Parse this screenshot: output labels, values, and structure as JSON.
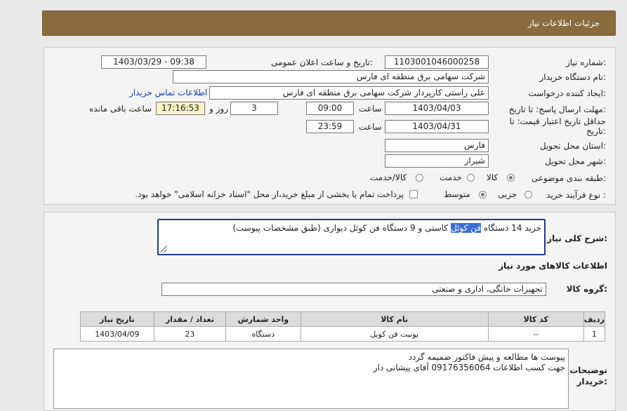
{
  "header": {
    "title": "جزئیات اطلاعات نیاز"
  },
  "form": {
    "need_number": {
      "label": "شماره نیاز:",
      "value": "1103001046000258"
    },
    "announce_datetime": {
      "label": "تاریخ و ساعت اعلان عمومی:",
      "value": "1403/03/29 - 09:38"
    },
    "buyer_org": {
      "label": "نام دستگاه خریدار:",
      "value": "شرکت سهامی برق منطقه ای فارس"
    },
    "requester": {
      "label": "ایجاد کننده درخواست:",
      "value": "علی راستی کارپرداز شرکت سهامی برق منطقه ای فارس",
      "contact_link": "اطلاعات تماس خریدار"
    },
    "reply_deadline": {
      "label": "مهلت ارسال پاسخ: تا تاریخ:",
      "date": "1403/04/03",
      "time_label": "ساعت",
      "time": "09:00",
      "days": "3",
      "days_label": "روز و",
      "remaining": "17:16:53",
      "remaining_label": "ساعت باقی مانده"
    },
    "price_validity": {
      "label": "حداقل تاریخ اعتبار قیمت: تا تاریخ:",
      "date": "1403/04/31",
      "time_label": "ساعت",
      "time": "23:59"
    },
    "province": {
      "label": "استان محل تحویل:",
      "value": "فارس"
    },
    "city": {
      "label": "شهر محل تحویل:",
      "value": "شیراز"
    },
    "category": {
      "label": "طبقه بندی موضوعی:",
      "options": [
        "کالا",
        "خدمت",
        "کالا/خدمت"
      ],
      "selected": "کالا"
    },
    "process_type": {
      "label": "نوع فرآیند خرید :",
      "options": [
        "جزیی",
        "متوسط"
      ],
      "selected": "متوسط",
      "payment_note": "پرداخت تمام یا بخشی از مبلغ خرید،از محل \"اسناد خزانه اسلامی\" خواهد بود."
    }
  },
  "description": {
    "label": "شرح کلی نیاز:",
    "text_before": "خرید 14 دستگاه ",
    "text_highlight": "فن کوئل",
    "text_after": " کاستی و 9 دستگاه فن کوئل دیواری (طبق مشخصات پیوست)"
  },
  "goods": {
    "section_title": "اطلاعات کالاهای مورد نیاز",
    "group_label": "گروه کالا:",
    "group_value": "تجهیزات خانگی، اداری و صنعتی",
    "table": {
      "columns": [
        "ردیف",
        "کد کالا",
        "نام کالا",
        "واحد شمارش",
        "تعداد / مقدار",
        "تاریخ نیاز"
      ],
      "rows": [
        [
          "1",
          "--",
          "یونیت فن کویل",
          "دستگاه",
          "23",
          "1403/04/09"
        ]
      ]
    }
  },
  "buyer_notes": {
    "label": "توضیحات خریدار:",
    "lines": [
      "پیوست ها مطالعه و پیش فاکتور ضمیمه گردد",
      "جهت کسب اطلاعات 09176356064 آقای پیشانی دار"
    ]
  }
}
